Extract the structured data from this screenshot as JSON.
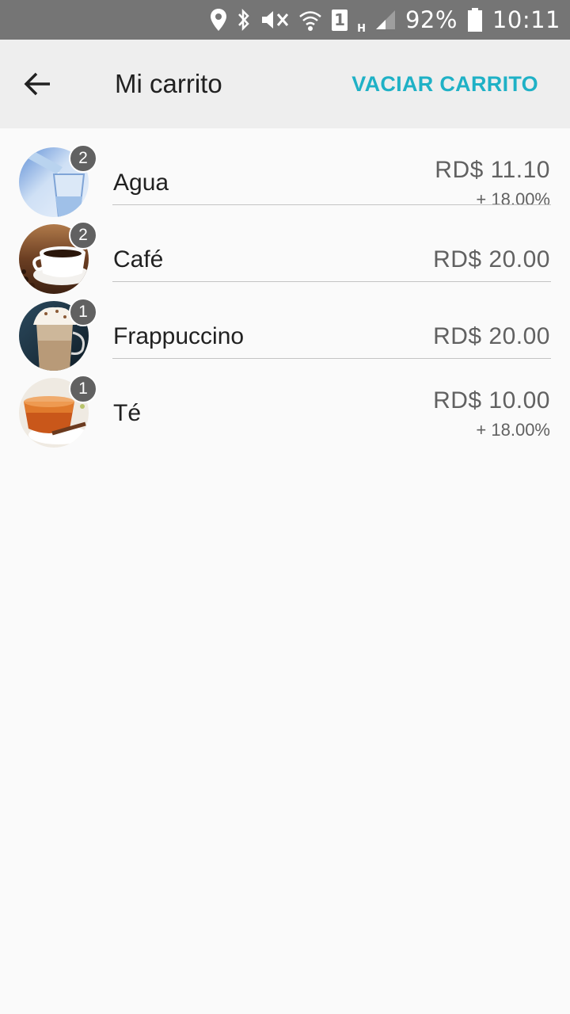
{
  "status_bar": {
    "battery_percent": "92%",
    "time": "10:11",
    "sim_label": "1",
    "network_type": "H",
    "icons": [
      "location-icon",
      "bluetooth-icon",
      "vibrate-icon",
      "wifi-icon",
      "sim-icon",
      "signal-icon",
      "battery-icon"
    ]
  },
  "header": {
    "title": "Mi carrito",
    "empty_cart_label": "VACIAR CARRITO",
    "accent_color": "#1fb1c6"
  },
  "cart": {
    "items": [
      {
        "name": "Agua",
        "quantity": "2",
        "price": "RD$ 11.10",
        "tax": "+ 18.00%",
        "image": "water-image"
      },
      {
        "name": "Café",
        "quantity": "2",
        "price": "RD$ 20.00",
        "image": "coffee-image"
      },
      {
        "name": "Frappuccino",
        "quantity": "1",
        "price": "RD$ 20.00",
        "image": "frappuccino-image"
      },
      {
        "name": "Té",
        "quantity": "1",
        "price": "RD$ 10.00",
        "tax": "+ 18.00%",
        "image": "tea-image"
      }
    ]
  }
}
